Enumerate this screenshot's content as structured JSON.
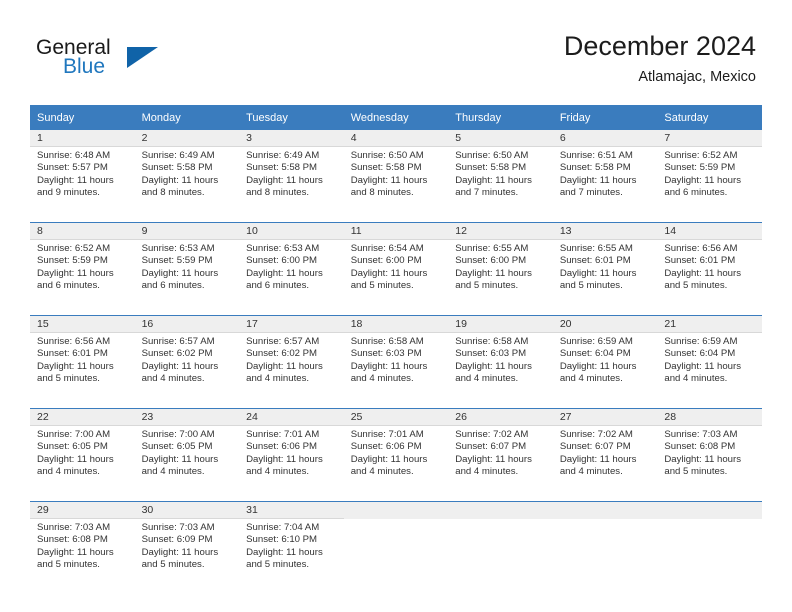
{
  "brand": {
    "name_part1": "General",
    "name_part2": "Blue",
    "logo_icon": "triangle-logo-icon",
    "accent_color": "#1063a8",
    "text_color": "#2077be"
  },
  "header": {
    "title": "December 2024",
    "location": "Atlamajac, Mexico"
  },
  "calendar": {
    "header_bg": "#3a7cbe",
    "header_text_color": "#ffffff",
    "daynum_bg": "#efefef",
    "weekdays": [
      "Sunday",
      "Monday",
      "Tuesday",
      "Wednesday",
      "Thursday",
      "Friday",
      "Saturday"
    ],
    "weeks": [
      [
        {
          "day": "1",
          "sunrise": "Sunrise: 6:48 AM",
          "sunset": "Sunset: 5:57 PM",
          "daylight_line1": "Daylight: 11 hours",
          "daylight_line2": "and 9 minutes."
        },
        {
          "day": "2",
          "sunrise": "Sunrise: 6:49 AM",
          "sunset": "Sunset: 5:58 PM",
          "daylight_line1": "Daylight: 11 hours",
          "daylight_line2": "and 8 minutes."
        },
        {
          "day": "3",
          "sunrise": "Sunrise: 6:49 AM",
          "sunset": "Sunset: 5:58 PM",
          "daylight_line1": "Daylight: 11 hours",
          "daylight_line2": "and 8 minutes."
        },
        {
          "day": "4",
          "sunrise": "Sunrise: 6:50 AM",
          "sunset": "Sunset: 5:58 PM",
          "daylight_line1": "Daylight: 11 hours",
          "daylight_line2": "and 8 minutes."
        },
        {
          "day": "5",
          "sunrise": "Sunrise: 6:50 AM",
          "sunset": "Sunset: 5:58 PM",
          "daylight_line1": "Daylight: 11 hours",
          "daylight_line2": "and 7 minutes."
        },
        {
          "day": "6",
          "sunrise": "Sunrise: 6:51 AM",
          "sunset": "Sunset: 5:58 PM",
          "daylight_line1": "Daylight: 11 hours",
          "daylight_line2": "and 7 minutes."
        },
        {
          "day": "7",
          "sunrise": "Sunrise: 6:52 AM",
          "sunset": "Sunset: 5:59 PM",
          "daylight_line1": "Daylight: 11 hours",
          "daylight_line2": "and 6 minutes."
        }
      ],
      [
        {
          "day": "8",
          "sunrise": "Sunrise: 6:52 AM",
          "sunset": "Sunset: 5:59 PM",
          "daylight_line1": "Daylight: 11 hours",
          "daylight_line2": "and 6 minutes."
        },
        {
          "day": "9",
          "sunrise": "Sunrise: 6:53 AM",
          "sunset": "Sunset: 5:59 PM",
          "daylight_line1": "Daylight: 11 hours",
          "daylight_line2": "and 6 minutes."
        },
        {
          "day": "10",
          "sunrise": "Sunrise: 6:53 AM",
          "sunset": "Sunset: 6:00 PM",
          "daylight_line1": "Daylight: 11 hours",
          "daylight_line2": "and 6 minutes."
        },
        {
          "day": "11",
          "sunrise": "Sunrise: 6:54 AM",
          "sunset": "Sunset: 6:00 PM",
          "daylight_line1": "Daylight: 11 hours",
          "daylight_line2": "and 5 minutes."
        },
        {
          "day": "12",
          "sunrise": "Sunrise: 6:55 AM",
          "sunset": "Sunset: 6:00 PM",
          "daylight_line1": "Daylight: 11 hours",
          "daylight_line2": "and 5 minutes."
        },
        {
          "day": "13",
          "sunrise": "Sunrise: 6:55 AM",
          "sunset": "Sunset: 6:01 PM",
          "daylight_line1": "Daylight: 11 hours",
          "daylight_line2": "and 5 minutes."
        },
        {
          "day": "14",
          "sunrise": "Sunrise: 6:56 AM",
          "sunset": "Sunset: 6:01 PM",
          "daylight_line1": "Daylight: 11 hours",
          "daylight_line2": "and 5 minutes."
        }
      ],
      [
        {
          "day": "15",
          "sunrise": "Sunrise: 6:56 AM",
          "sunset": "Sunset: 6:01 PM",
          "daylight_line1": "Daylight: 11 hours",
          "daylight_line2": "and 5 minutes."
        },
        {
          "day": "16",
          "sunrise": "Sunrise: 6:57 AM",
          "sunset": "Sunset: 6:02 PM",
          "daylight_line1": "Daylight: 11 hours",
          "daylight_line2": "and 4 minutes."
        },
        {
          "day": "17",
          "sunrise": "Sunrise: 6:57 AM",
          "sunset": "Sunset: 6:02 PM",
          "daylight_line1": "Daylight: 11 hours",
          "daylight_line2": "and 4 minutes."
        },
        {
          "day": "18",
          "sunrise": "Sunrise: 6:58 AM",
          "sunset": "Sunset: 6:03 PM",
          "daylight_line1": "Daylight: 11 hours",
          "daylight_line2": "and 4 minutes."
        },
        {
          "day": "19",
          "sunrise": "Sunrise: 6:58 AM",
          "sunset": "Sunset: 6:03 PM",
          "daylight_line1": "Daylight: 11 hours",
          "daylight_line2": "and 4 minutes."
        },
        {
          "day": "20",
          "sunrise": "Sunrise: 6:59 AM",
          "sunset": "Sunset: 6:04 PM",
          "daylight_line1": "Daylight: 11 hours",
          "daylight_line2": "and 4 minutes."
        },
        {
          "day": "21",
          "sunrise": "Sunrise: 6:59 AM",
          "sunset": "Sunset: 6:04 PM",
          "daylight_line1": "Daylight: 11 hours",
          "daylight_line2": "and 4 minutes."
        }
      ],
      [
        {
          "day": "22",
          "sunrise": "Sunrise: 7:00 AM",
          "sunset": "Sunset: 6:05 PM",
          "daylight_line1": "Daylight: 11 hours",
          "daylight_line2": "and 4 minutes."
        },
        {
          "day": "23",
          "sunrise": "Sunrise: 7:00 AM",
          "sunset": "Sunset: 6:05 PM",
          "daylight_line1": "Daylight: 11 hours",
          "daylight_line2": "and 4 minutes."
        },
        {
          "day": "24",
          "sunrise": "Sunrise: 7:01 AM",
          "sunset": "Sunset: 6:06 PM",
          "daylight_line1": "Daylight: 11 hours",
          "daylight_line2": "and 4 minutes."
        },
        {
          "day": "25",
          "sunrise": "Sunrise: 7:01 AM",
          "sunset": "Sunset: 6:06 PM",
          "daylight_line1": "Daylight: 11 hours",
          "daylight_line2": "and 4 minutes."
        },
        {
          "day": "26",
          "sunrise": "Sunrise: 7:02 AM",
          "sunset": "Sunset: 6:07 PM",
          "daylight_line1": "Daylight: 11 hours",
          "daylight_line2": "and 4 minutes."
        },
        {
          "day": "27",
          "sunrise": "Sunrise: 7:02 AM",
          "sunset": "Sunset: 6:07 PM",
          "daylight_line1": "Daylight: 11 hours",
          "daylight_line2": "and 4 minutes."
        },
        {
          "day": "28",
          "sunrise": "Sunrise: 7:03 AM",
          "sunset": "Sunset: 6:08 PM",
          "daylight_line1": "Daylight: 11 hours",
          "daylight_line2": "and 5 minutes."
        }
      ],
      [
        {
          "day": "29",
          "sunrise": "Sunrise: 7:03 AM",
          "sunset": "Sunset: 6:08 PM",
          "daylight_line1": "Daylight: 11 hours",
          "daylight_line2": "and 5 minutes."
        },
        {
          "day": "30",
          "sunrise": "Sunrise: 7:03 AM",
          "sunset": "Sunset: 6:09 PM",
          "daylight_line1": "Daylight: 11 hours",
          "daylight_line2": "and 5 minutes."
        },
        {
          "day": "31",
          "sunrise": "Sunrise: 7:04 AM",
          "sunset": "Sunset: 6:10 PM",
          "daylight_line1": "Daylight: 11 hours",
          "daylight_line2": "and 5 minutes."
        },
        {
          "day": "",
          "sunrise": "",
          "sunset": "",
          "daylight_line1": "",
          "daylight_line2": "",
          "empty": true
        },
        {
          "day": "",
          "sunrise": "",
          "sunset": "",
          "daylight_line1": "",
          "daylight_line2": "",
          "empty": true
        },
        {
          "day": "",
          "sunrise": "",
          "sunset": "",
          "daylight_line1": "",
          "daylight_line2": "",
          "empty": true
        },
        {
          "day": "",
          "sunrise": "",
          "sunset": "",
          "daylight_line1": "",
          "daylight_line2": "",
          "empty": true
        }
      ]
    ]
  }
}
